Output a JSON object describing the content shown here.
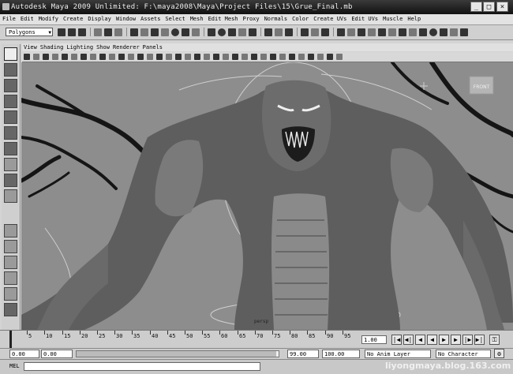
{
  "window": {
    "title": "Autodesk Maya 2009 Unlimited: F:\\maya2008\\Maya\\Project Files\\15\\Grue_Final.mb",
    "min": "_",
    "max": "□",
    "close": "×"
  },
  "menu": [
    "File",
    "Edit",
    "Modify",
    "Create",
    "Display",
    "Window",
    "Assets",
    "Select",
    "Mesh",
    "Edit Mesh",
    "Proxy",
    "Normals",
    "Color",
    "Create UVs",
    "Edit UVs",
    "Muscle",
    "Help"
  ],
  "status_line": {
    "mode": "Polygons"
  },
  "viewport": {
    "menu": [
      "View",
      "Shading",
      "Lighting",
      "Show",
      "Renderer",
      "Panels"
    ],
    "view_cube_label": "FRONT",
    "object_label": "persp"
  },
  "time_slider": {
    "ticks": [
      "5",
      "10",
      "15",
      "20",
      "25",
      "30",
      "35",
      "40",
      "45",
      "50",
      "55",
      "60",
      "65",
      "70",
      "75",
      "80",
      "85",
      "90",
      "95"
    ],
    "current_frame": "1.00",
    "playback": [
      "|◀",
      "◀|",
      "◀",
      "◀",
      "▶",
      "▶",
      "|▶",
      "▶|"
    ]
  },
  "range_slider": {
    "start": "0.00",
    "playback_start": "0.00",
    "playback_end": "99.00",
    "end": "100.00",
    "anim_layer": "No Anim Layer",
    "character_set": "No Character Set"
  },
  "command_line": {
    "label": "MEL"
  },
  "watermark": "liyongmaya.blog.163.com"
}
